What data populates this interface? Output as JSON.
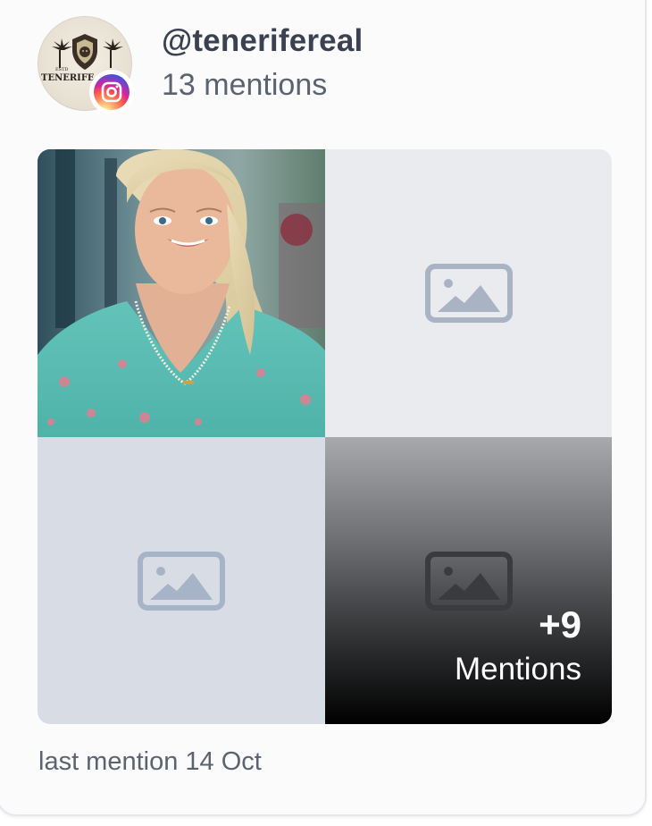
{
  "account": {
    "handle": "@tenerifereal",
    "mentions_count": "13 mentions",
    "avatar_text": "TENERIFE",
    "avatar_estd": "ESTD",
    "platform_icon": "instagram-icon"
  },
  "grid": {
    "cells": [
      {
        "type": "photo",
        "icon": "woman-photo"
      },
      {
        "type": "placeholder",
        "icon": "image-placeholder-icon"
      },
      {
        "type": "placeholder",
        "icon": "image-placeholder-icon"
      },
      {
        "type": "more",
        "icon": "image-placeholder-icon"
      }
    ],
    "more_count": "+9",
    "more_label": "Mentions"
  },
  "footer": {
    "last_mention": "last mention 14 Oct"
  },
  "colors": {
    "handle": "#3a4150",
    "muted_text": "#5c6370",
    "placeholder_light": "#eaebef",
    "placeholder_mid": "#d8dce4",
    "placeholder_icon": "#a7b3c6"
  }
}
